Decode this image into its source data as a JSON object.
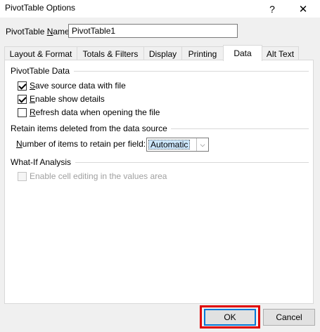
{
  "window": {
    "title": "PivotTable Options",
    "help_glyph": "?",
    "close_glyph": "✕"
  },
  "name_field": {
    "label_pre": "PivotTable ",
    "label_accel": "N",
    "label_post": "ame:",
    "value": "PivotTable1"
  },
  "tabs": [
    {
      "label": "Layout & Format",
      "active": false
    },
    {
      "label": "Totals & Filters",
      "active": false
    },
    {
      "label": "Display",
      "active": false
    },
    {
      "label": "Printing",
      "active": false
    },
    {
      "label": "Data",
      "active": true
    },
    {
      "label": "Alt Text",
      "active": false
    }
  ],
  "pivot_data_group": {
    "title": "PivotTable Data",
    "save_source": {
      "accel": "S",
      "rest": "ave source data with file",
      "checked": true
    },
    "enable_details": {
      "accel": "E",
      "rest": "nable show details",
      "checked": true
    },
    "refresh_on_open": {
      "accel": "R",
      "rest": "efresh data when opening the file",
      "checked": false
    }
  },
  "retain_group": {
    "title": "Retain items deleted from the data source",
    "label_pre": "",
    "label_accel": "N",
    "label_post": "umber of items to retain per field:",
    "selected": "Automatic",
    "arrow_glyph": "⌵"
  },
  "whatif_group": {
    "title": "What-If Analysis",
    "enable_cell_editing": {
      "label": "Enable cell editing in the values area",
      "checked": false,
      "disabled": true
    }
  },
  "buttons": {
    "ok": "OK",
    "cancel": "Cancel"
  },
  "colors": {
    "highlight": "#e00000",
    "ok_focus": "#0078d7",
    "selection": "#cde8ff"
  }
}
